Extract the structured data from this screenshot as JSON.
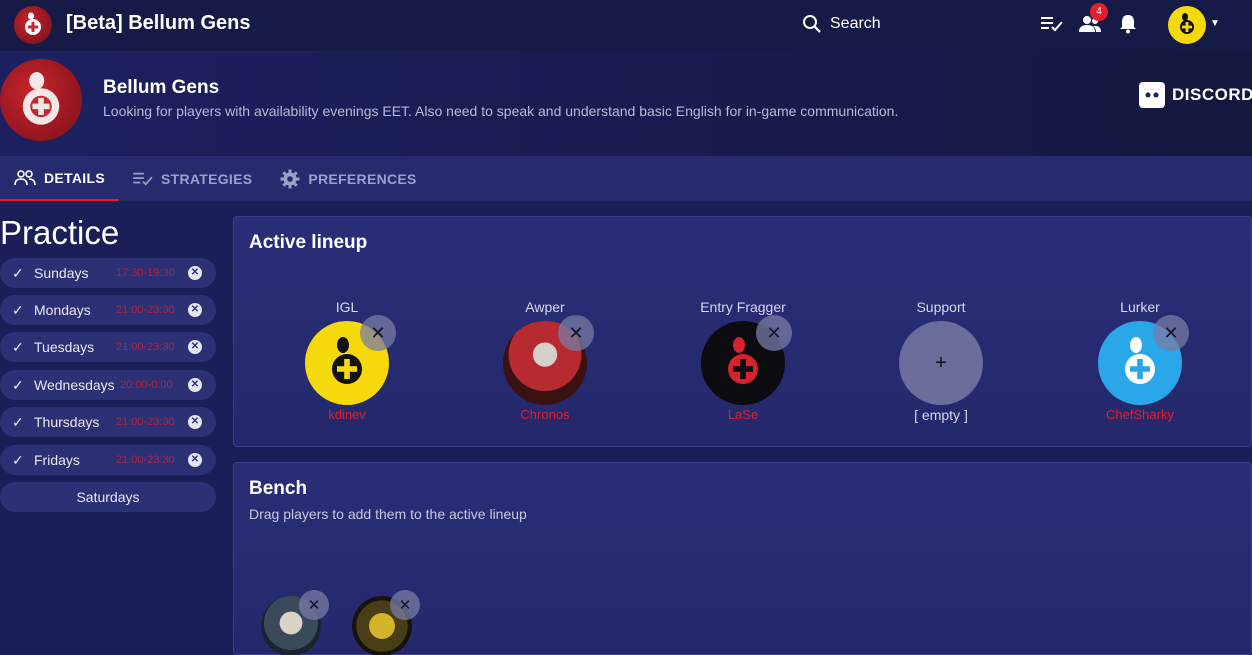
{
  "app": {
    "title": "[Beta] Bellum Gens"
  },
  "search": {
    "label": "Search"
  },
  "top_icons": {
    "notifications_count": "4"
  },
  "team": {
    "name": "Bellum Gens",
    "description": "Looking for players with availability evenings EET. Also need to speak and understand basic English for in-game communication.",
    "discord_label": "DISCORD"
  },
  "tabs": [
    {
      "label": "DETAILS",
      "icon": "group-icon",
      "active": true
    },
    {
      "label": "STRATEGIES",
      "icon": "playlist-check-icon",
      "active": false
    },
    {
      "label": "PREFERENCES",
      "icon": "gear-icon",
      "active": false
    }
  ],
  "practice": {
    "title": "Practice",
    "days": [
      {
        "label": "Sundays",
        "time": "17:30-19:30"
      },
      {
        "label": "Mondays",
        "time": "21:00-23:30"
      },
      {
        "label": "Tuesdays",
        "time": "21:00-23:30"
      },
      {
        "label": "Wednesdays",
        "time": "20:00-0:00"
      },
      {
        "label": "Thursdays",
        "time": "21:00-23:30"
      },
      {
        "label": "Fridays",
        "time": "21:00-23:30"
      },
      {
        "label": "Saturdays",
        "time": ""
      }
    ]
  },
  "lineup": {
    "title": "Active lineup",
    "slots": [
      {
        "role": "IGL",
        "name": "kdinev",
        "color": "#f5d90a"
      },
      {
        "role": "Awper",
        "name": "Chronos",
        "color": "#a8262c"
      },
      {
        "role": "Entry Fragger",
        "name": "LaSe",
        "color": "#0b0b10"
      },
      {
        "role": "Support",
        "name": "[ empty ]",
        "color": "#6a6e9a"
      },
      {
        "role": "Lurker",
        "name": "ChefSharky",
        "color": "#29a7e8"
      }
    ]
  },
  "bench": {
    "title": "Bench",
    "subtitle": "Drag players to add them to the active lineup"
  },
  "colors": {
    "accent": "#e0202c",
    "background": "#1b1f58",
    "topbar": "#161a46"
  }
}
